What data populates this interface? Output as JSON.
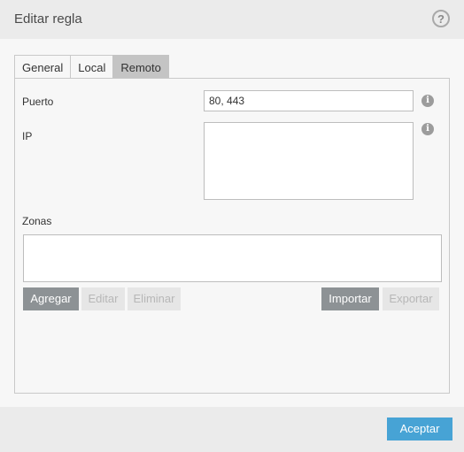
{
  "dialog": {
    "title": "Editar regla",
    "help_icon": "?"
  },
  "tabs": [
    {
      "label": "General",
      "active": false
    },
    {
      "label": "Local",
      "active": false
    },
    {
      "label": "Remoto",
      "active": true
    }
  ],
  "form": {
    "port": {
      "label": "Puerto",
      "value": "80, 443",
      "info_icon": "i"
    },
    "ip": {
      "label": "IP",
      "value": "",
      "info_icon": "i"
    },
    "zones": {
      "label": "Zonas",
      "value": ""
    }
  },
  "zone_buttons": {
    "add": {
      "label": "Agregar",
      "enabled": true
    },
    "edit": {
      "label": "Editar",
      "enabled": false
    },
    "delete": {
      "label": "Eliminar",
      "enabled": false
    },
    "import": {
      "label": "Importar",
      "enabled": true
    },
    "export": {
      "label": "Exportar",
      "enabled": false
    }
  },
  "footer": {
    "accept_label": "Aceptar"
  },
  "colors": {
    "accent": "#47a3d5",
    "active_button": "#8d9295",
    "disabled_button": "#e6e6e6"
  }
}
